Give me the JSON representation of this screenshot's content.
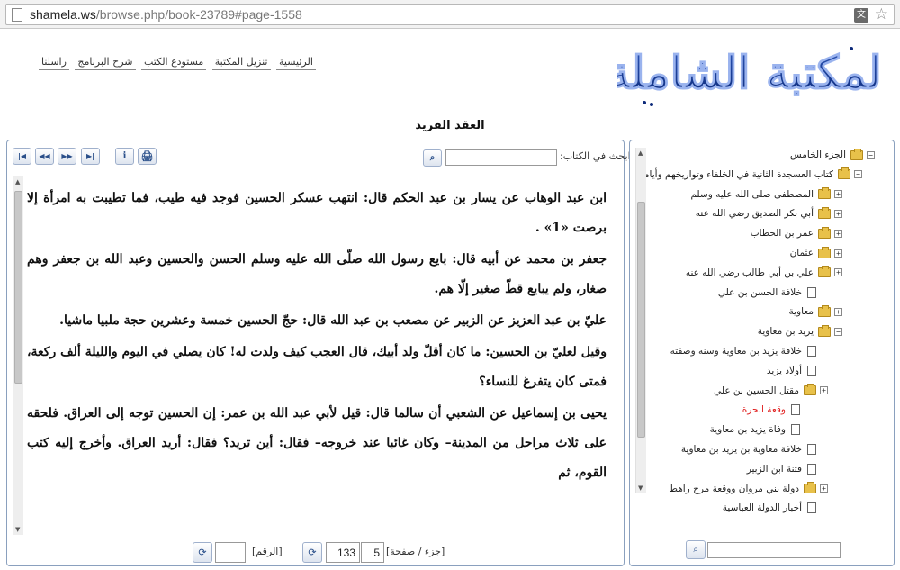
{
  "browser": {
    "url_host": "shamela.ws",
    "url_path": "/browse.php/book-23789#page-1558",
    "translate_icon": "translate-icon",
    "star_icon": "star-icon"
  },
  "header": {
    "logo_text": "المكتبة الشاملة",
    "nav": [
      "الرئيسية",
      "تنزيل المكتبة",
      "مستودع الكتب",
      "شرح البرنامج",
      "راسلنا"
    ],
    "book_title": "العقد الفريد"
  },
  "toolbar": {
    "search_label": "ابحث في الكتاب:",
    "search_value": "",
    "buttons": {
      "first": "|◀",
      "prev": "◀◀",
      "next": "▶▶",
      "last": "▶|",
      "info": "i",
      "print": "🖨"
    }
  },
  "content": {
    "paragraphs": [
      "ابن عبد الوهاب عن يسار بن عبد الحكم قال: انتهب عسكر الحسين فوجد فيه طيب، فما تطيبت به امرأة إلا برصت «1» .",
      "جعفر بن محمد عن أبيه قال: بايع رسول الله صلّى الله عليه وسلم الحسن والحسين وعبد الله بن جعفر وهم صغار، ولم يبايع قطّ صغير إلّا هم.",
      "عليّ بن عبد العزيز عن الزبير عن مصعب بن عبد الله قال: حجّ الحسين خمسة وعشرين حجة ملبيا ماشيا.",
      "وقيل لعليّ بن الحسين: ما كان أقلّ ولد أبيك، قال العجب كيف ولدت له! كان يصلي في اليوم والليلة ألف ركعة، فمتى كان يتفرغ للنساء؟",
      "يحيى بن إسماعيل عن الشعبي أن سالما قال: قيل لأبي عبد الله بن عمر: إن الحسين توجه إلى العراق. فلحقه على ثلاث مراحل من المدينة– وكان غائبا عند خروجه– فقال: أين تريد؟ فقال: أريد العراق. وأخرج إليه كتب القوم، ثم"
    ]
  },
  "pager": {
    "part_page_label": "[جزء / صفحة]",
    "part_value": "5",
    "page_value": "133",
    "number_label": "[الرقم]",
    "number_value": ""
  },
  "tree": {
    "search_value": "",
    "nodes": [
      {
        "label": "الجزء الخامس",
        "icon": "folder",
        "exp": "−"
      },
      {
        "label": "كتاب العسجدة الثانية في الخلفاء وتواريخهم وأيامهم",
        "icon": "folder",
        "exp": "−"
      },
      {
        "label": "المصطفى صلى الله عليه وسلم",
        "icon": "folder",
        "exp": "+"
      },
      {
        "label": "أبي بكر الصديق رضي الله عنه",
        "icon": "folder",
        "exp": "+"
      },
      {
        "label": "عمر بن الخطاب",
        "icon": "folder",
        "exp": "+"
      },
      {
        "label": "عثمان",
        "icon": "folder",
        "exp": "+"
      },
      {
        "label": "علي بن أبي طالب رضي الله عنه",
        "icon": "folder",
        "exp": "+"
      },
      {
        "label": "خلافة الحسن بن علي",
        "icon": "doc",
        "exp": ""
      },
      {
        "label": "معاوية",
        "icon": "folder",
        "exp": "+"
      },
      {
        "label": "يزيد بن معاوية",
        "icon": "folder",
        "exp": "−"
      },
      {
        "label": "خلافة يزيد بن معاوية وسنه وصفته",
        "icon": "doc",
        "exp": ""
      },
      {
        "label": "أولاد يزيد",
        "icon": "doc",
        "exp": ""
      },
      {
        "label": "مقتل الحسين بن علي",
        "icon": "folder",
        "exp": "+"
      },
      {
        "label": "وقعة الحرة",
        "icon": "doc",
        "exp": "",
        "active": true
      },
      {
        "label": "وفاة يزيد بن معاوية",
        "icon": "doc",
        "exp": ""
      },
      {
        "label": "خلافة معاوية بن يزيد بن معاوية",
        "icon": "doc",
        "exp": ""
      },
      {
        "label": "فتنة ابن الزبير",
        "icon": "doc",
        "exp": ""
      },
      {
        "label": "دولة بني مروان ووقعة مرج راهط",
        "icon": "folder",
        "exp": "+"
      },
      {
        "label": "أخبار الدولة العباسية",
        "icon": "doc",
        "exp": ""
      }
    ]
  }
}
